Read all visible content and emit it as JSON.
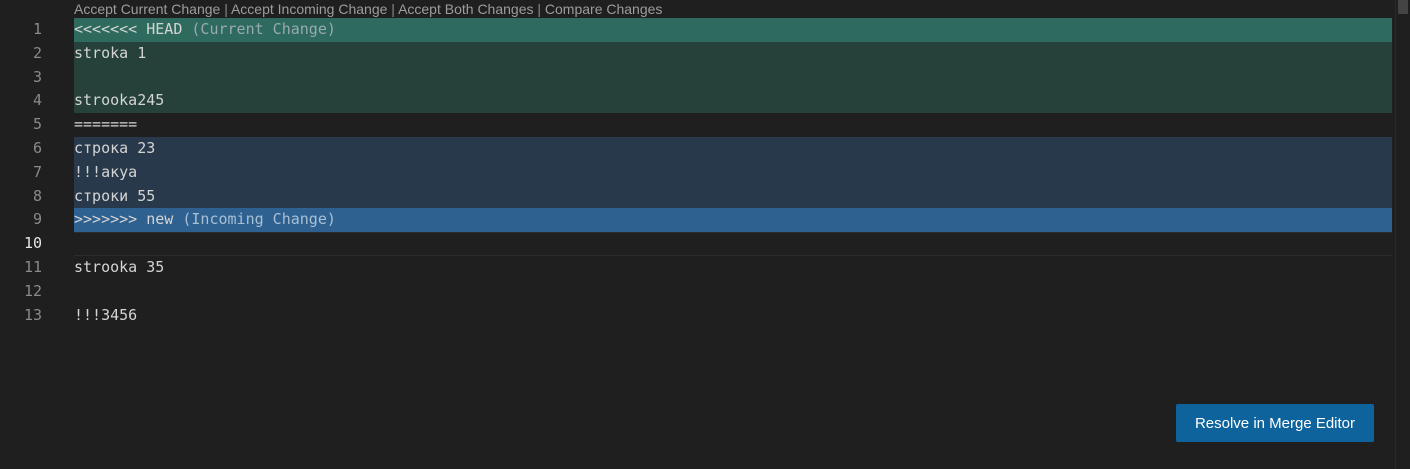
{
  "codelens": {
    "accept_current": "Accept Current Change",
    "accept_incoming": "Accept Incoming Change",
    "accept_both": "Accept Both Changes",
    "compare": "Compare Changes",
    "separator": " | "
  },
  "lines": [
    {
      "number": "1",
      "text": "<<<<<<< HEAD",
      "annotation": " (Current Change)"
    },
    {
      "number": "2",
      "text": "stroka 1"
    },
    {
      "number": "3",
      "text": ""
    },
    {
      "number": "4",
      "text": "strooka245"
    },
    {
      "number": "5",
      "text": "======="
    },
    {
      "number": "6",
      "text": "строка 23"
    },
    {
      "number": "7",
      "text": "!!!акуа"
    },
    {
      "number": "8",
      "text": "строки 55"
    },
    {
      "number": "9",
      "text": ">>>>>>> new",
      "annotation": " (Incoming Change)"
    },
    {
      "number": "10",
      "text": ""
    },
    {
      "number": "11",
      "text": "strooka 35"
    },
    {
      "number": "12",
      "text": ""
    },
    {
      "number": "13",
      "text": "!!!3456"
    }
  ],
  "active_line": "10",
  "resolve_button": {
    "label": "Resolve in Merge Editor"
  },
  "colors": {
    "editor_bg": "#1f1f1f",
    "current_header": "#2e6b5e",
    "current_body": "#26413a",
    "incoming_header": "#2f6190",
    "incoming_body": "#27394a",
    "button_bg": "#0e639c"
  }
}
